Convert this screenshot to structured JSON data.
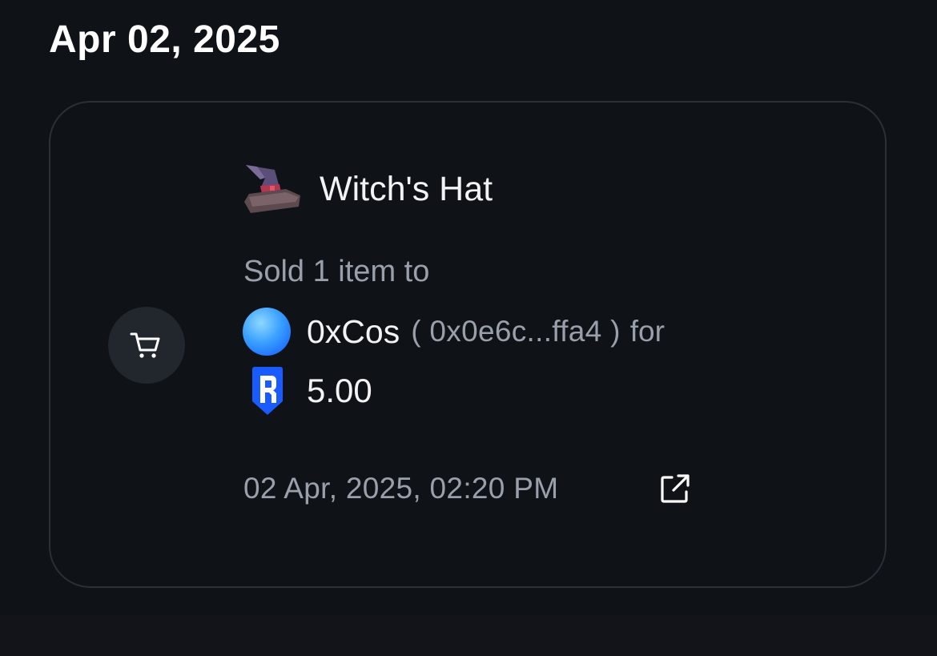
{
  "header": {
    "date": "Apr 02, 2025"
  },
  "activity": {
    "type_icon": "shopping-cart-icon",
    "item": {
      "icon": "witch-hat-icon",
      "name": "Witch's Hat"
    },
    "action_text": "Sold 1 item to",
    "buyer": {
      "avatar": "gradient-avatar",
      "name": "0xCos",
      "address": "( 0x0e6c...ffa4 )",
      "suffix": "for"
    },
    "price": {
      "token_icon": "ronin-token-icon",
      "amount": "5.00"
    },
    "timestamp": "02 Apr, 2025, 02:20 PM",
    "link_icon": "external-link-icon"
  },
  "colors": {
    "background": "#0f1217",
    "card_border": "#2a2f38",
    "secondary_text": "#9aa0ab",
    "primary_text": "#f2f3f5",
    "ronin_blue": "#1a5bff"
  }
}
